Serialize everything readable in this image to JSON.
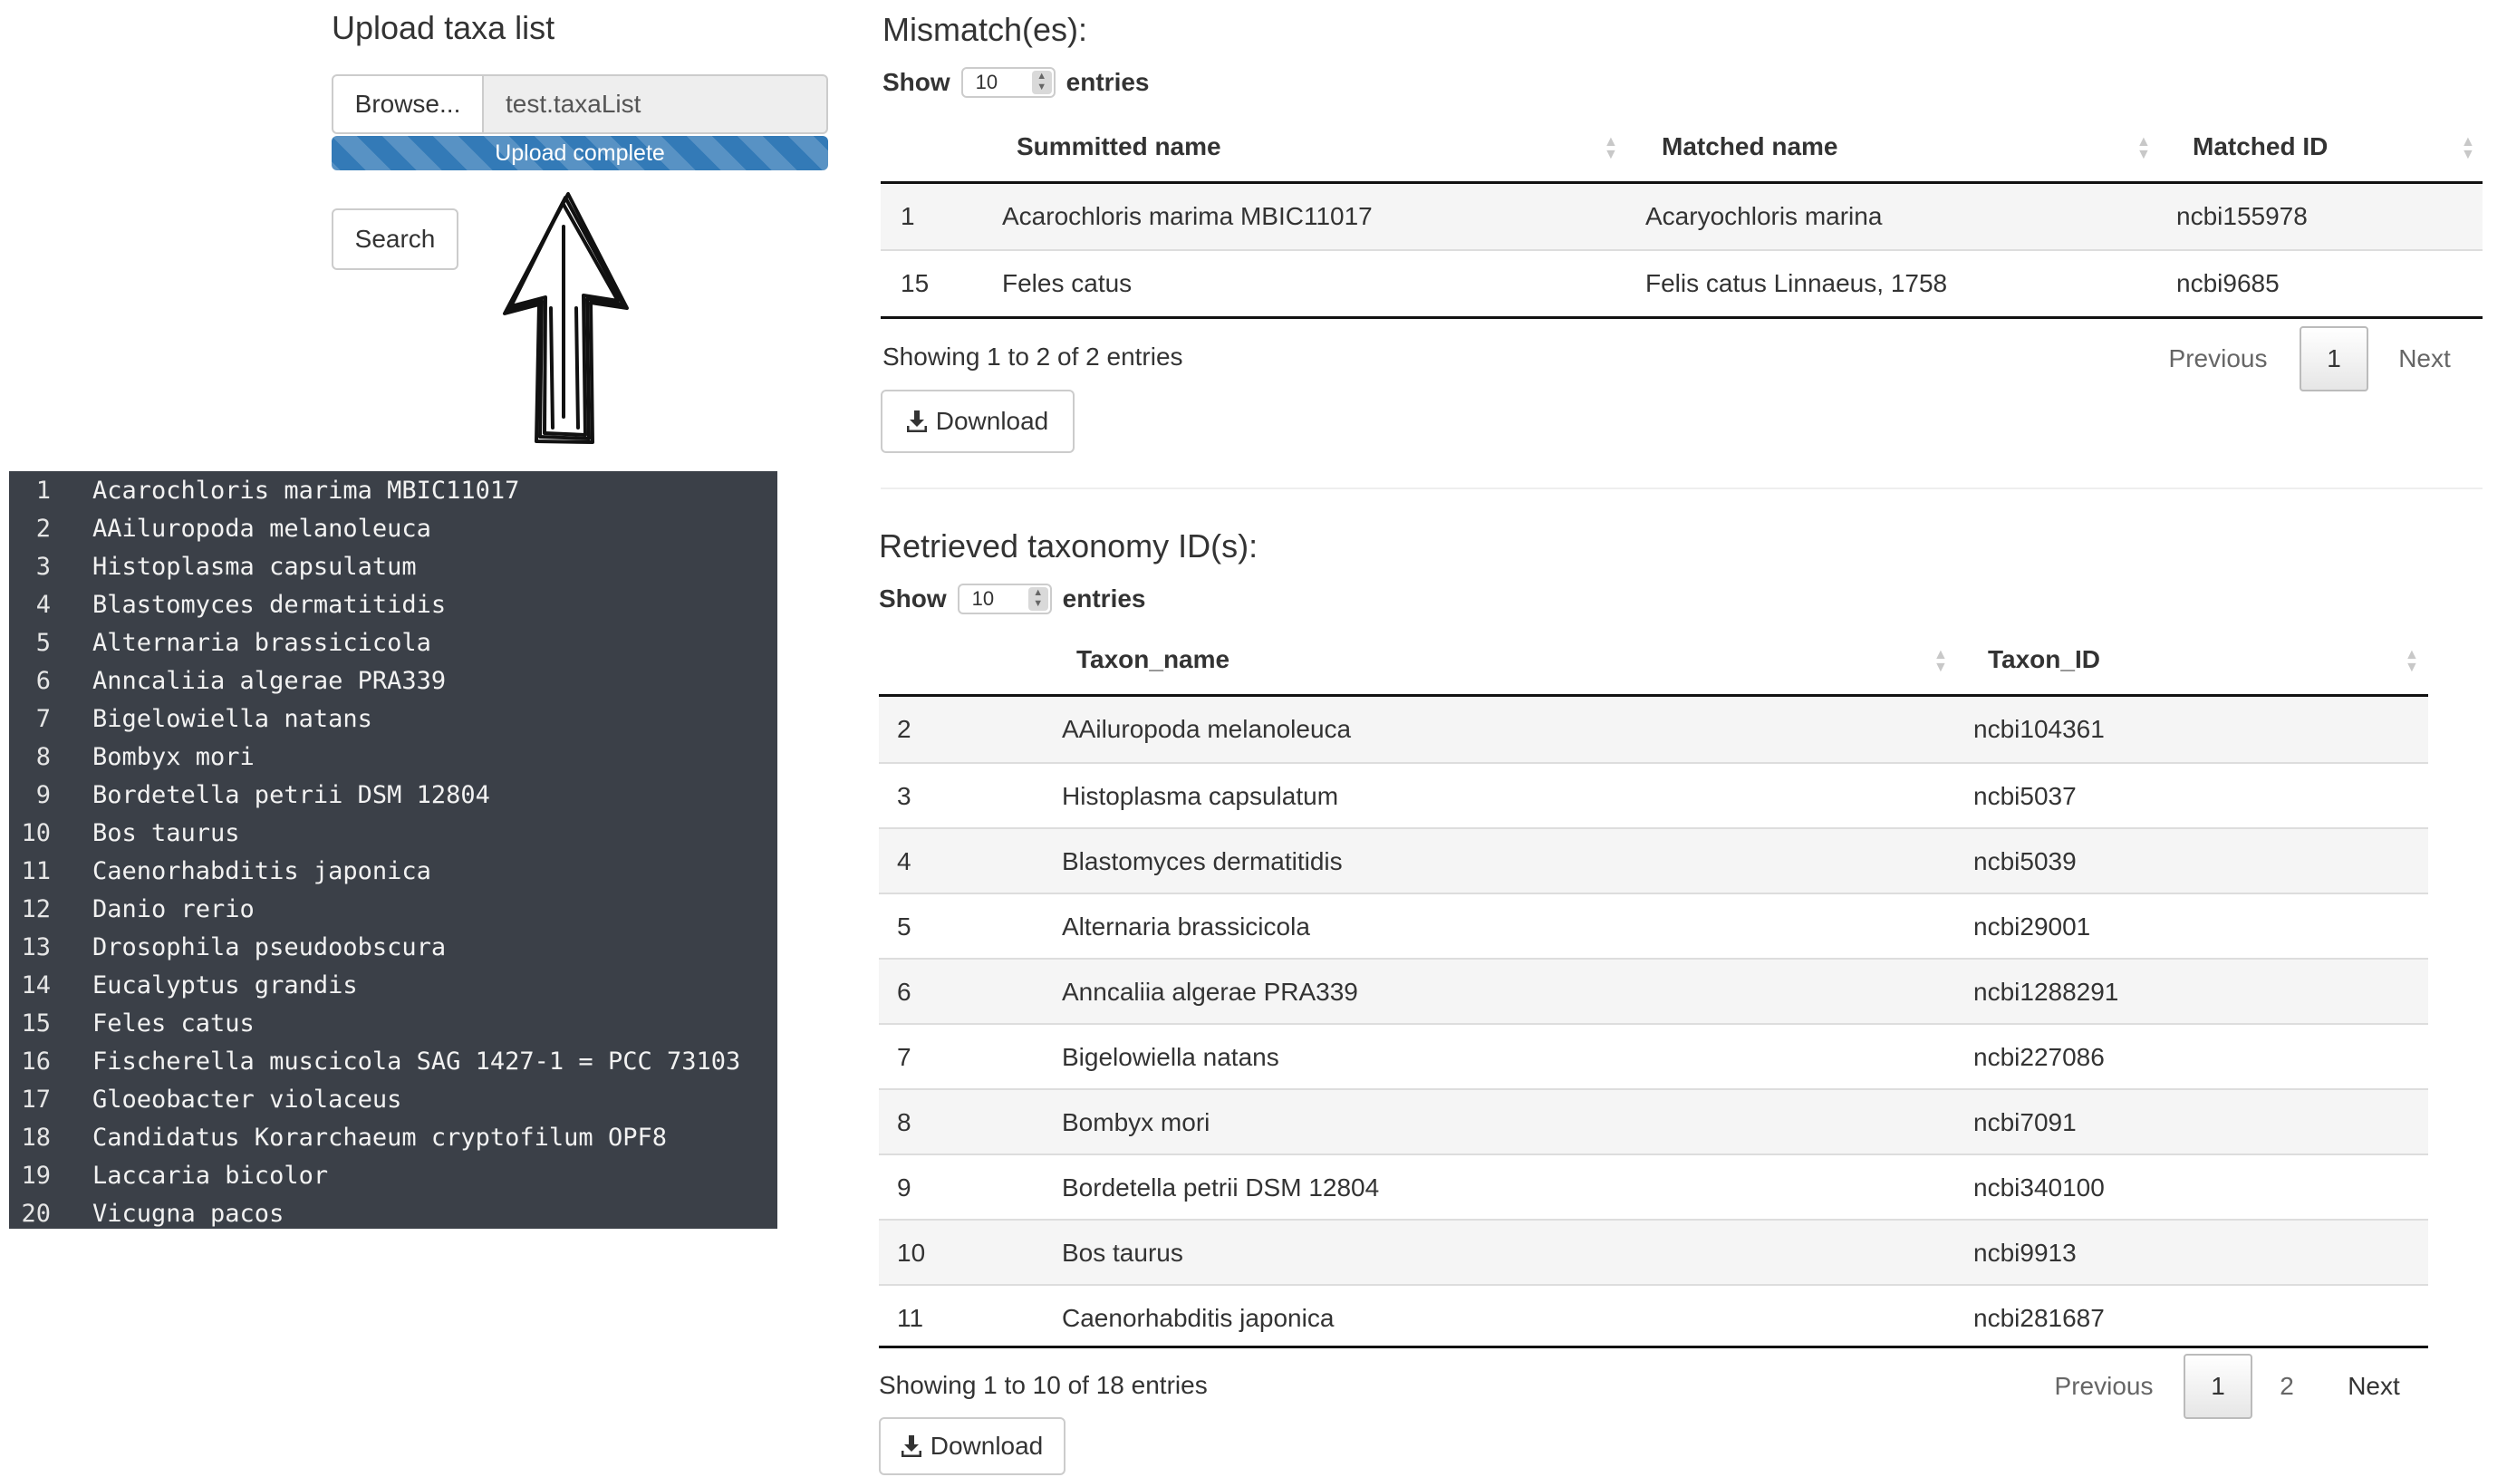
{
  "upload": {
    "title": "Upload taxa list",
    "browse_label": "Browse...",
    "file_name": "test.taxaList",
    "progress_label": "Upload complete",
    "search_label": "Search"
  },
  "code_listing": [
    {
      "n": "1",
      "text": "Acarochloris marima MBIC11017"
    },
    {
      "n": "2",
      "text": "AAiluropoda melanoleuca"
    },
    {
      "n": "3",
      "text": "Histoplasma capsulatum"
    },
    {
      "n": "4",
      "text": "Blastomyces dermatitidis"
    },
    {
      "n": "5",
      "text": "Alternaria brassicicola"
    },
    {
      "n": "6",
      "text": "Anncaliia algerae PRA339"
    },
    {
      "n": "7",
      "text": "Bigelowiella natans"
    },
    {
      "n": "8",
      "text": "Bombyx mori"
    },
    {
      "n": "9",
      "text": "Bordetella petrii DSM 12804"
    },
    {
      "n": "10",
      "text": "Bos taurus"
    },
    {
      "n": "11",
      "text": "Caenorhabditis japonica"
    },
    {
      "n": "12",
      "text": "Danio rerio"
    },
    {
      "n": "13",
      "text": "Drosophila pseudoobscura"
    },
    {
      "n": "14",
      "text": "Eucalyptus grandis"
    },
    {
      "n": "15",
      "text": "Feles catus"
    },
    {
      "n": "16",
      "text": "Fischerella muscicola SAG 1427-1 = PCC 73103"
    },
    {
      "n": "17",
      "text": "Gloeobacter violaceus"
    },
    {
      "n": "18",
      "text": "Candidatus Korarchaeum cryptofilum OPF8"
    },
    {
      "n": "19",
      "text": "Laccaria bicolor"
    },
    {
      "n": "20",
      "text": "Vicugna pacos"
    }
  ],
  "mismatch": {
    "title": "Mismatch(es):",
    "show_label": "Show",
    "entries_label": "entries",
    "page_length": "10",
    "columns": [
      "Summitted name",
      "Matched name",
      "Matched ID"
    ],
    "rows": [
      [
        "1",
        "Acarochloris marima MBIC11017",
        "Acaryochloris marina",
        "ncbi155978"
      ],
      [
        "15",
        "Feles catus",
        "Felis catus Linnaeus, 1758",
        "ncbi9685"
      ]
    ],
    "info": "Showing 1 to 2 of 2 entries",
    "pagination": {
      "previous": "Previous",
      "pages": [
        "1"
      ],
      "next": "Next"
    },
    "download_label": "Download"
  },
  "retrieved": {
    "title": "Retrieved taxonomy ID(s):",
    "show_label": "Show",
    "entries_label": "entries",
    "page_length": "10",
    "columns": [
      "Taxon_name",
      "Taxon_ID"
    ],
    "rows": [
      [
        "2",
        "AAiluropoda melanoleuca",
        "ncbi104361"
      ],
      [
        "3",
        "Histoplasma capsulatum",
        "ncbi5037"
      ],
      [
        "4",
        "Blastomyces dermatitidis",
        "ncbi5039"
      ],
      [
        "5",
        "Alternaria brassicicola",
        "ncbi29001"
      ],
      [
        "6",
        "Anncaliia algerae PRA339",
        "ncbi1288291"
      ],
      [
        "7",
        "Bigelowiella natans",
        "ncbi227086"
      ],
      [
        "8",
        "Bombyx mori",
        "ncbi7091"
      ],
      [
        "9",
        "Bordetella petrii DSM 12804",
        "ncbi340100"
      ],
      [
        "10",
        "Bos taurus",
        "ncbi9913"
      ],
      [
        "11",
        "Caenorhabditis japonica",
        "ncbi281687"
      ]
    ],
    "info": "Showing 1 to 10 of 18 entries",
    "pagination": {
      "previous": "Previous",
      "pages": [
        "1",
        "2"
      ],
      "next": "Next"
    },
    "download_label": "Download"
  }
}
